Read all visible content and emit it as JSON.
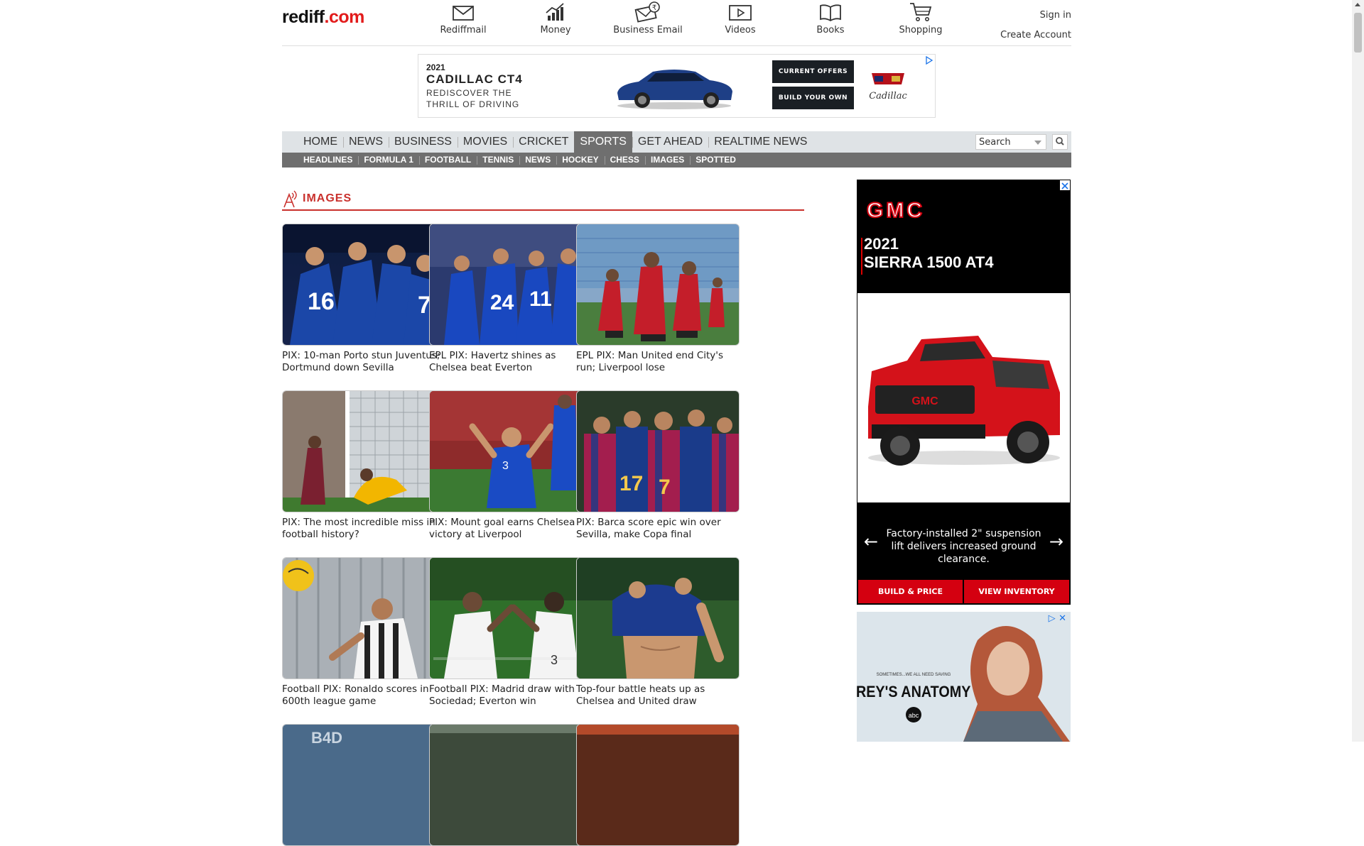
{
  "logo": {
    "text": "rediff",
    "suffix": ".com"
  },
  "topnav": [
    {
      "label": "Rediffmail",
      "icon": "mail-icon"
    },
    {
      "label": "Money",
      "icon": "chart-icon"
    },
    {
      "label": "Business Email",
      "icon": "business-mail-icon"
    },
    {
      "label": "Videos",
      "icon": "video-icon"
    },
    {
      "label": "Books",
      "icon": "book-icon"
    },
    {
      "label": "Shopping",
      "icon": "cart-icon"
    }
  ],
  "account": {
    "signin": "Sign in",
    "create": "Create Account"
  },
  "top_ad": {
    "year": "2021",
    "model": "CADILLAC CT4",
    "tagline": "REDISCOVER THE THRILL OF DRIVING",
    "btn1": "CURRENT OFFERS",
    "btn2": "BUILD YOUR OWN",
    "brand": "Cadillac"
  },
  "mainnav": [
    {
      "label": "HOME"
    },
    {
      "label": "NEWS"
    },
    {
      "label": "BUSINESS"
    },
    {
      "label": "MOVIES"
    },
    {
      "label": "CRICKET"
    },
    {
      "label": "SPORTS",
      "active": true
    },
    {
      "label": "GET AHEAD"
    },
    {
      "label": "REALTIME NEWS"
    }
  ],
  "search": {
    "placeholder": "Search"
  },
  "subnav": [
    "HEADLINES",
    "FORMULA 1",
    "FOOTBALL",
    "TENNIS",
    "NEWS",
    "HOCKEY",
    "CHESS",
    "IMAGES",
    "SPOTTED"
  ],
  "section": {
    "title": "IMAGES"
  },
  "cards": [
    {
      "caption": "PIX: 10-man Porto stun Juventus; Dortmund down Sevilla"
    },
    {
      "caption": "EPL PIX: Havertz shines as Chelsea beat Everton"
    },
    {
      "caption": "EPL PIX: Man United end City's run; Liverpool lose"
    },
    {
      "caption": "PIX: The most incredible miss in football history?"
    },
    {
      "caption": "PIX: Mount goal earns Chelsea victory at Liverpool"
    },
    {
      "caption": "PIX: Barca score epic win over Sevilla, make Copa final"
    },
    {
      "caption": "Football PIX: Ronaldo scores in 600th league game"
    },
    {
      "caption": "Football PIX: Madrid draw with Sociedad; Everton win"
    },
    {
      "caption": "Top-four battle heats up as Chelsea and United draw"
    }
  ],
  "right_ad": {
    "brand": "GMC",
    "year": "2021",
    "model": "SIERRA 1500 AT4",
    "message": "Factory-installed 2\" suspension lift delivers increased ground clearance.",
    "btn1": "BUILD & PRICE",
    "btn2": "VIEW INVENTORY"
  },
  "right_ad2": {
    "line1": "SOMETIMES...WE ALL NEED SAVING",
    "title": "GREY'S ANATOMY",
    "network": "abc"
  }
}
